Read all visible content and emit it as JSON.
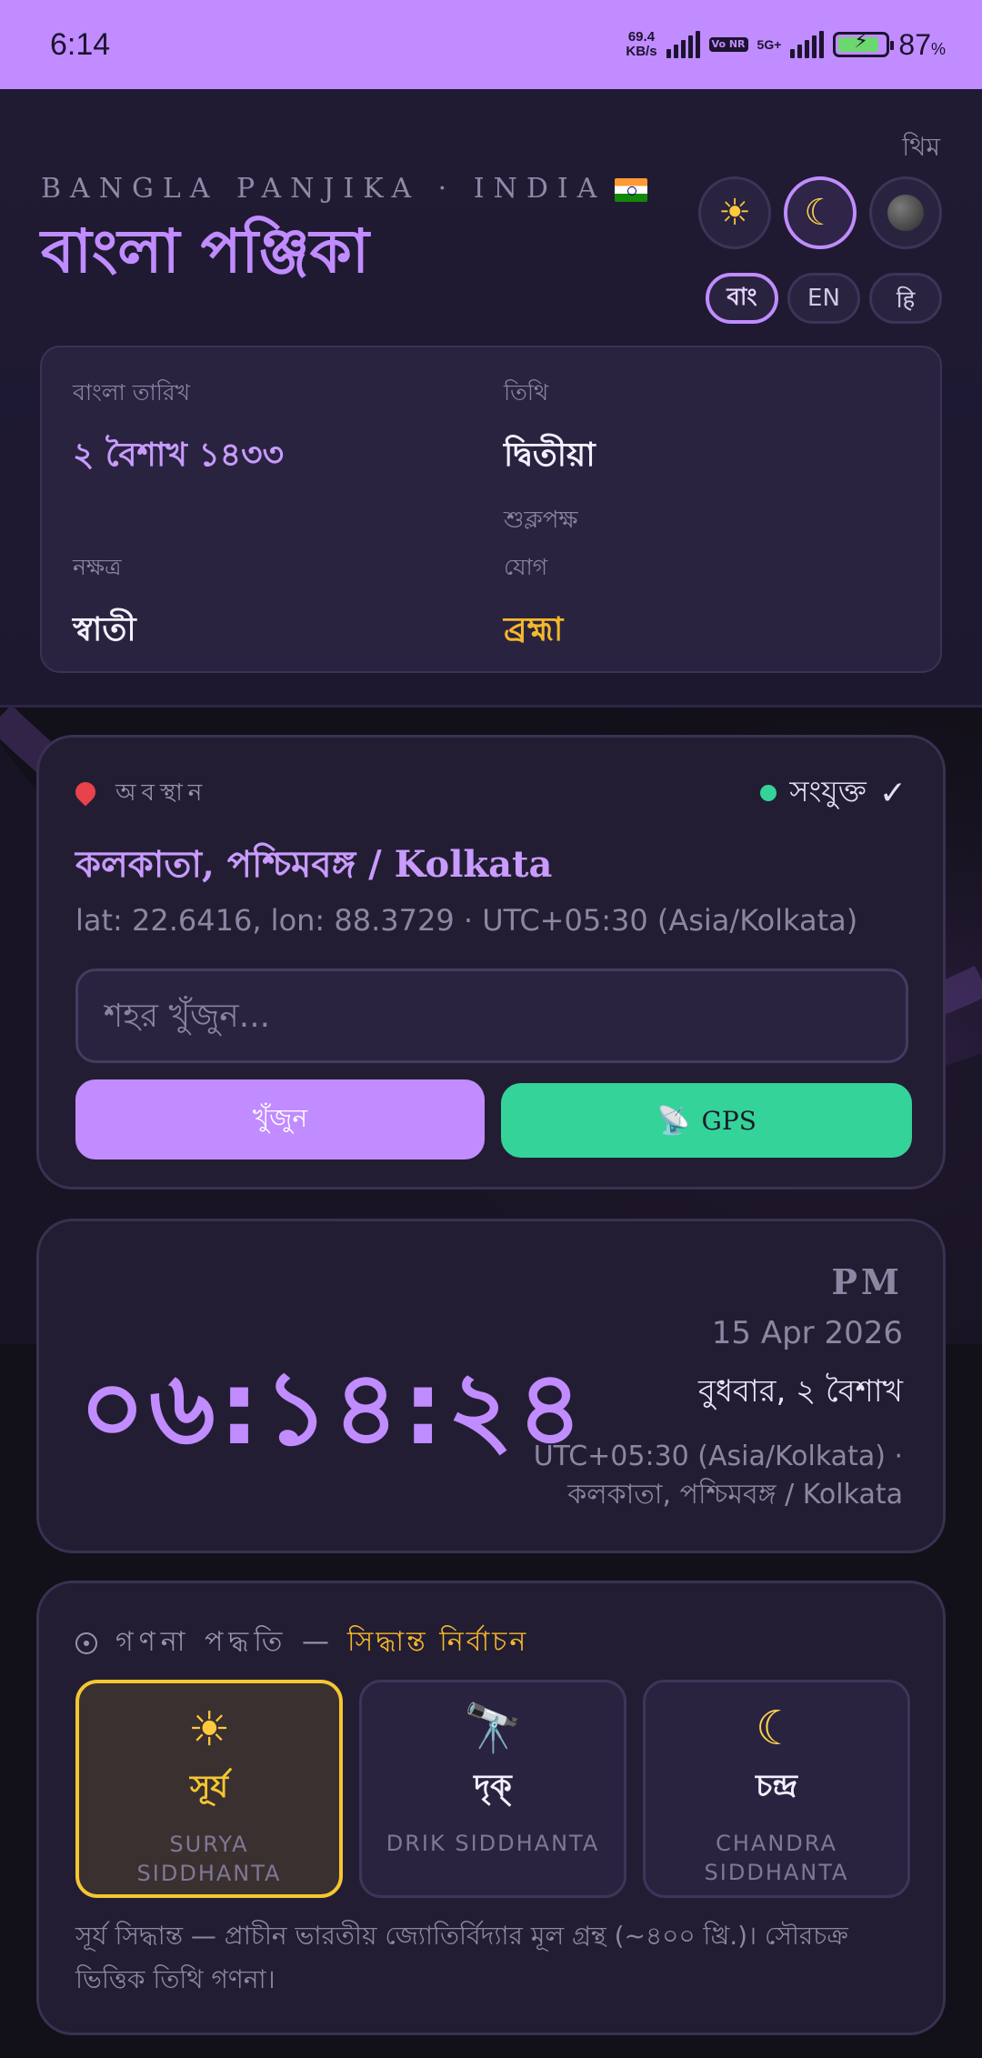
{
  "status_bar": {
    "time": "6:14",
    "net_speed_value": "69.4",
    "net_speed_unit": "KB/s",
    "volte": "Vo NR",
    "network": "5G+",
    "battery_percent": "87",
    "battery_unit": "%",
    "battery_level": 0.87
  },
  "header": {
    "theme_label": "থিম",
    "brand_subtitle": "BANGLA PANJIKA · INDIA",
    "brand_title": "বাংলা পঞ্জিকা",
    "theme_buttons": [
      {
        "icon": "sun-icon",
        "active": false
      },
      {
        "icon": "moon-icon",
        "active": true
      },
      {
        "icon": "dark-circle-icon",
        "active": false
      }
    ],
    "languages": [
      {
        "label": "বাং",
        "active": true
      },
      {
        "label": "EN",
        "active": false
      },
      {
        "label": "हि",
        "active": false
      }
    ]
  },
  "today": {
    "bangla_date_label": "বাংলা তারিখ",
    "bangla_date": "২ বৈশাখ ১৪৩৩",
    "tithi_label": "তিথি",
    "tithi": "দ্বিতীয়া",
    "paksha": "শুক্লপক্ষ",
    "nakshatra_label": "নক্ষত্র",
    "nakshatra": "স্বাতী",
    "yoga_label": "যোগ",
    "yoga": "ব্রহ্মা"
  },
  "location": {
    "heading": "অবস্থান",
    "status": "সংযুক্ত",
    "city": "কলকাতা, পশ্চিমবঙ্গ / Kolkata",
    "coords": "lat: 22.6416, lon: 88.3729 · UTC+05:30 (Asia/Kolkata)",
    "search_placeholder": "শহর খুঁজুন...",
    "search_button": "খুঁজুন",
    "gps_button": "GPS"
  },
  "clock": {
    "time": "০৬:১৪:২৪",
    "ampm": "PM",
    "date": "15 Apr 2026",
    "day": "বুধবার, ২ বৈশাখ",
    "timezone": "UTC+05:30 (Asia/Kolkata) ·",
    "place": "কলকাতা, পশ্চিমবঙ্গ / Kolkata"
  },
  "method": {
    "heading": "গণনা পদ্ধতি —",
    "heading_highlight": "সিদ্ধান্ত নির্বাচন",
    "options": [
      {
        "icon": "sun-icon",
        "name": "সূর্য",
        "en": "SURYA SIDDHANTA",
        "active": true
      },
      {
        "icon": "telescope-icon",
        "name": "দৃক্",
        "en": "DRIK SIDDHANTA",
        "active": false
      },
      {
        "icon": "crescent-moon-icon",
        "name": "চন্দ্র",
        "en": "CHANDRA SIDDHANTA",
        "active": false
      }
    ],
    "description": "সূর্য সিদ্ধান্ত — প্রাচীন ভারতীয় জ্যোতির্বিদ্যার মূল গ্রন্থ (~৪০০ খ্রি.)। সৌরচক্র ভিত্তিক তিথি গণনা।"
  }
}
